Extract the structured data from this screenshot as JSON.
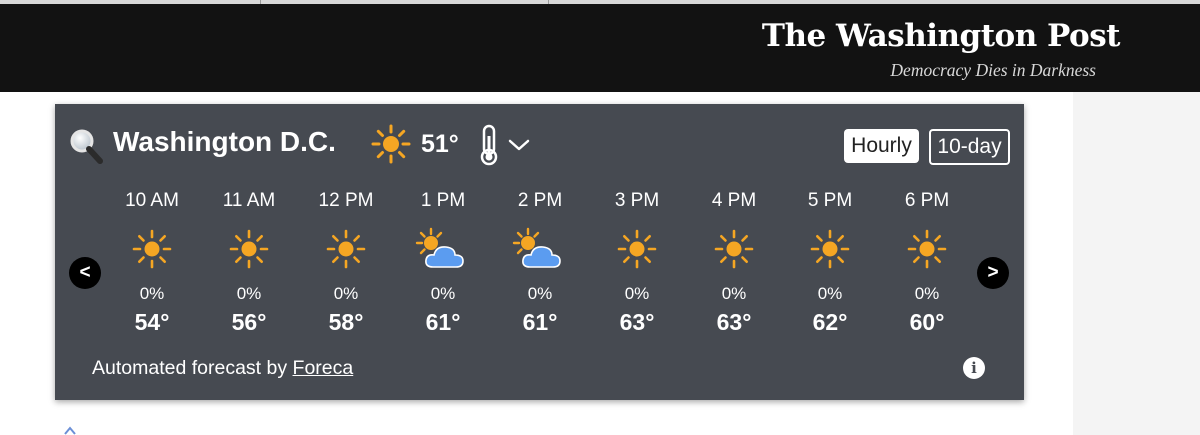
{
  "masthead": {
    "logo": "The Washington Post",
    "tagline": "Democracy Dies in Darkness"
  },
  "weather": {
    "location": "Washington D.C.",
    "current_temp": "51°",
    "current_icon": "sun-icon",
    "tabs": {
      "hourly": "Hourly",
      "ten_day": "10-day"
    },
    "nav": {
      "prev": "<",
      "next": ">"
    },
    "hours": [
      {
        "time": "10 AM",
        "icon": "sun-icon",
        "precip": "0%",
        "temp": "54°"
      },
      {
        "time": "11 AM",
        "icon": "sun-icon",
        "precip": "0%",
        "temp": "56°"
      },
      {
        "time": "12 PM",
        "icon": "sun-icon",
        "precip": "0%",
        "temp": "58°"
      },
      {
        "time": "1 PM",
        "icon": "partly-cloudy-icon",
        "precip": "0%",
        "temp": "61°"
      },
      {
        "time": "2 PM",
        "icon": "partly-cloudy-icon",
        "precip": "0%",
        "temp": "61°"
      },
      {
        "time": "3 PM",
        "icon": "sun-icon",
        "precip": "0%",
        "temp": "63°"
      },
      {
        "time": "4 PM",
        "icon": "sun-icon",
        "precip": "0%",
        "temp": "63°"
      },
      {
        "time": "5 PM",
        "icon": "sun-icon",
        "precip": "0%",
        "temp": "62°"
      },
      {
        "time": "6 PM",
        "icon": "sun-icon",
        "precip": "0%",
        "temp": "60°"
      }
    ],
    "footer": {
      "text": "Automated forecast by ",
      "link": "Foreca"
    },
    "info_icon": "i",
    "colors": {
      "panel": "#464a51",
      "sun": "#f5a623",
      "cloud": "#5b9cf0",
      "masthead": "#121212"
    }
  }
}
